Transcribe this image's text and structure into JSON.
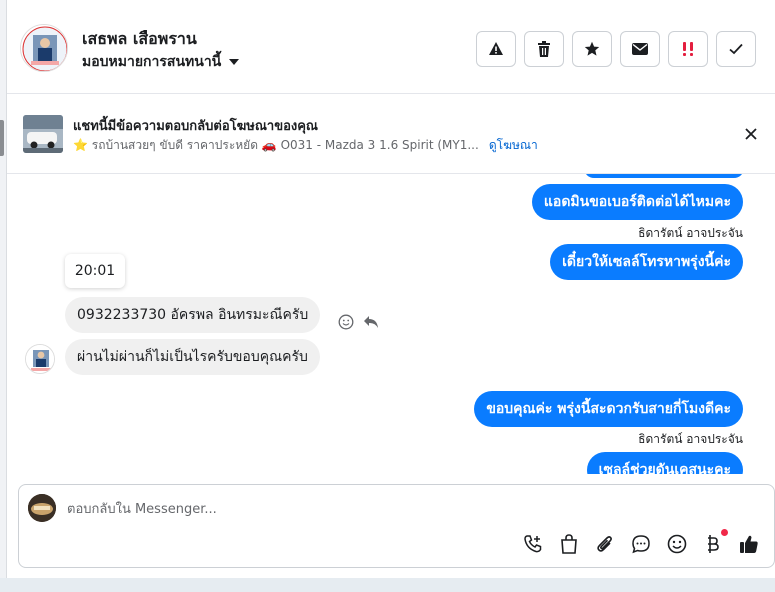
{
  "header": {
    "contact_name": "เสธพล เสือพราน",
    "assign_label": "มอบหมายการสนทนานี้",
    "actions": [
      {
        "icon": "warning-icon"
      },
      {
        "icon": "trash-icon"
      },
      {
        "icon": "star-icon"
      },
      {
        "icon": "envelope-icon"
      },
      {
        "icon": "follow-up-icon"
      },
      {
        "icon": "checkmark-icon"
      }
    ]
  },
  "ad_banner": {
    "title": "แชทนี้มีข้อความตอบกลับต่อโฆษณาของคุณ",
    "subtitle": "⭐ รถบ้านสวยๆ ขับดี ราคาประหยัด 🚗 O031 - Mazda 3 1.6 Spirit (MY1...",
    "link_label": "ดูโฆษณา"
  },
  "messages": [
    {
      "id": "m1",
      "direction": "out",
      "text": "แอดมินขอเบอร์ติดต่อได้ไหมคะ"
    },
    {
      "id": "m1s",
      "sender": "ธิดารัตน์ อาจประจัน"
    },
    {
      "id": "m2",
      "direction": "out",
      "text": "เดี๋ยวให้เซลล์โทรหาพรุ่งนี้ค่ะ"
    },
    {
      "id": "t1",
      "time": "20:01"
    },
    {
      "id": "m3",
      "direction": "in",
      "text": "0932233730 อัครพล อินทรมะณีครับ"
    },
    {
      "id": "m4",
      "direction": "in",
      "text": "ผ่านไม่ผ่านก็ไม่เป็นไรครับขอบคุณครับ"
    },
    {
      "id": "m5",
      "direction": "out",
      "text": "ขอบคุณค่ะ พรุ่งนี้สะดวกรับสายกี่โมงดีคะ"
    },
    {
      "id": "m5s",
      "sender": "ธิดารัตน์ อาจประจัน"
    },
    {
      "id": "m6",
      "direction": "out",
      "text": "เซลล์ช่วยดันเคสนะคะ"
    }
  ],
  "composer": {
    "placeholder": "ตอบกลับใน Messenger...",
    "tools": [
      "call-add-icon",
      "shopping-bag-icon",
      "paperclip-icon",
      "speech-bubble-icon",
      "emoji-icon",
      "baht-icon",
      "thumbs-up-icon"
    ]
  },
  "colors": {
    "outgoing_bubble": "#0a7cff",
    "incoming_bubble": "#f0f0f0",
    "link": "#0064d1",
    "badge_red": "#f02849"
  }
}
